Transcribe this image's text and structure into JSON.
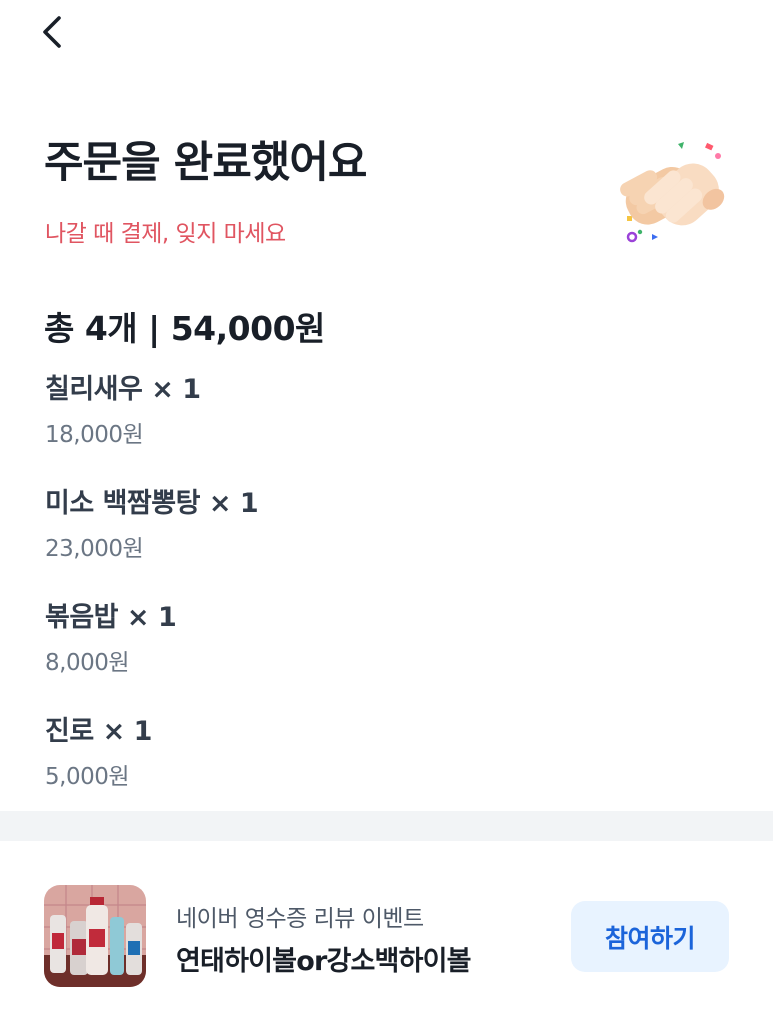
{
  "header": {
    "back_icon": "chevron-left-icon"
  },
  "hero": {
    "title": "주문을 완료했어요",
    "subtitle": "나갈 때 결제, 잊지 마세요",
    "subtitle_color": "#e05561",
    "illustration": "clapping-hands-emoji"
  },
  "order": {
    "summary": "총 4개 | 54,000원",
    "items": [
      {
        "name": "칠리새우 × 1",
        "price": "18,000원"
      },
      {
        "name": "미소 백짬뽕탕 × 1",
        "price": "23,000원"
      },
      {
        "name": "볶음밥 × 1",
        "price": "8,000원"
      },
      {
        "name": "진로 × 1",
        "price": "5,000원"
      }
    ]
  },
  "banner": {
    "caption": "네이버 영수증 리뷰 이벤트",
    "title": "연태하이볼or강소백하이볼",
    "button_label": "참여하기",
    "button_color": "#1b64da",
    "button_bg": "#e8f3ff"
  }
}
